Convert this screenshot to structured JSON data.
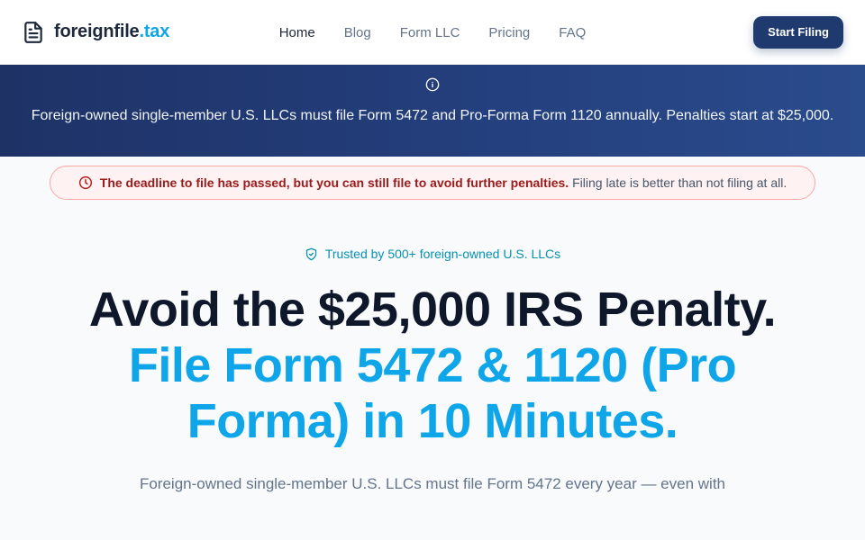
{
  "brand": {
    "name": "foreignfile",
    "tld": ".tax",
    "icon": "document-icon"
  },
  "nav": [
    {
      "label": "Home",
      "active": true
    },
    {
      "label": "Blog",
      "active": false
    },
    {
      "label": "Form LLC",
      "active": false
    },
    {
      "label": "Pricing",
      "active": false
    },
    {
      "label": "FAQ",
      "active": false
    }
  ],
  "header": {
    "cta_label": "Start Filing"
  },
  "banner": {
    "icon": "info-icon",
    "text": "Foreign-owned single-member U.S. LLCs must file Form 5472 and Pro-Forma Form 1120 annually. Penalties start at $25,000."
  },
  "alert": {
    "icon": "clock-icon",
    "strong": "The deadline to file has passed, but you can still file to avoid further penalties.",
    "rest": "Filing late is better than not filing at all."
  },
  "hero": {
    "trust_icon": "shield-check-icon",
    "trust_text": "Trusted by 500+ foreign-owned U.S. LLCs",
    "headline_line1": "Avoid the $25,000 IRS Penalty.",
    "headline_line2": "File Form 5472 & 1120 (Pro Forma) in 10 Minutes.",
    "subtext": "Foreign-owned single-member U.S. LLCs must file Form 5472 every year — even with"
  },
  "colors": {
    "brand_dark": "#1e3a6e",
    "accent": "#0ea5e9",
    "alert_red": "#991b1b",
    "trust_teal": "#0891b2"
  }
}
